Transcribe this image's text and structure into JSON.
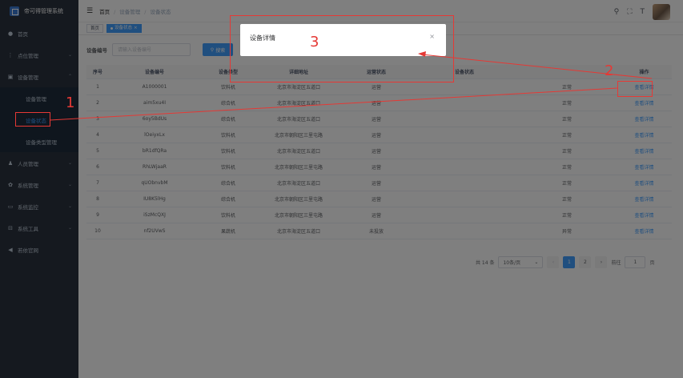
{
  "app": {
    "title": "帝可得管理系统",
    "icon": "logo-icon"
  },
  "sidebar": {
    "items": [
      {
        "icon": "home-icon",
        "label": "首页",
        "has_children": false
      },
      {
        "icon": "point-icon",
        "label": "点位管理",
        "has_children": true
      },
      {
        "icon": "device-icon",
        "label": "设备管理",
        "has_children": true,
        "expanded": true,
        "children": [
          {
            "label": "设备管理",
            "active": false
          },
          {
            "label": "设备状态",
            "active": true
          },
          {
            "label": "设备类型管理",
            "active": false
          }
        ]
      },
      {
        "icon": "user-icon",
        "label": "人员管理",
        "has_children": true
      },
      {
        "icon": "gear-icon",
        "label": "系统管理",
        "has_children": true
      },
      {
        "icon": "monitor-icon",
        "label": "系统监控",
        "has_children": true
      },
      {
        "icon": "tool-icon",
        "label": "系统工具",
        "has_children": true
      },
      {
        "icon": "send-icon",
        "label": "若依官网",
        "has_children": false
      }
    ]
  },
  "header": {
    "breadcrumb": [
      "首页",
      "设备管理",
      "设备状态"
    ],
    "icons": [
      "search-icon",
      "fullscreen-icon",
      "font-size-icon"
    ]
  },
  "tags": [
    {
      "label": "首页",
      "active": false
    },
    {
      "label": "设备状态",
      "active": true
    }
  ],
  "search": {
    "label": "设备编号",
    "placeholder": "请输入设备编号",
    "button": "搜索"
  },
  "table": {
    "columns": [
      "序号",
      "设备编号",
      "设备类型",
      "详细地址",
      "运营状态",
      "设备状态",
      "操作"
    ],
    "rows": [
      [
        "1",
        "A1000001",
        "饮料机",
        "北京市海淀区五道口",
        "运营",
        "正常",
        "查看详情"
      ],
      [
        "2",
        "aim5xu4I",
        "综合机",
        "北京市海淀区五道口",
        "运营",
        "正常",
        "查看详情"
      ],
      [
        "3",
        "6oy5BdUs",
        "综合机",
        "北京市海淀区五道口",
        "运营",
        "正常",
        "查看详情"
      ],
      [
        "4",
        "lOeiyxLx",
        "饮料机",
        "北京市朝阳区三里屯路",
        "运营",
        "正常",
        "查看详情"
      ],
      [
        "5",
        "bR1dfQRa",
        "饮料机",
        "北京市海淀区五道口",
        "运营",
        "正常",
        "查看详情"
      ],
      [
        "6",
        "RhLWjaaR",
        "饮料机",
        "北京市朝阳区三里屯路",
        "运营",
        "正常",
        "查看详情"
      ],
      [
        "7",
        "qUObnvbM",
        "综合机",
        "北京市海淀区五道口",
        "运营",
        "正常",
        "查看详情"
      ],
      [
        "8",
        "IU8K5lHg",
        "综合机",
        "北京市朝阳区三里屯路",
        "运营",
        "正常",
        "查看详情"
      ],
      [
        "9",
        "iSzMcQXJ",
        "饮料机",
        "北京市朝阳区三里屯路",
        "运营",
        "正常",
        "查看详情"
      ],
      [
        "10",
        "nf2UVwS",
        "果蔬机",
        "北京市海淀区五道口",
        "未投放",
        "异常",
        "查看详情"
      ]
    ]
  },
  "pagination": {
    "total": "共 14 条",
    "page_size": "10条/页",
    "pages": [
      "1",
      "2"
    ],
    "current": "1",
    "jump_label": "前往",
    "jump_value": "1",
    "page_suffix": "页"
  },
  "dialog": {
    "title": "设备详情",
    "close": "×"
  },
  "annotations": [
    "1",
    "2",
    "3"
  ],
  "colors": {
    "sidebar_bg": "#2b333e",
    "primary": "#409eff",
    "annotation": "#e53935"
  }
}
